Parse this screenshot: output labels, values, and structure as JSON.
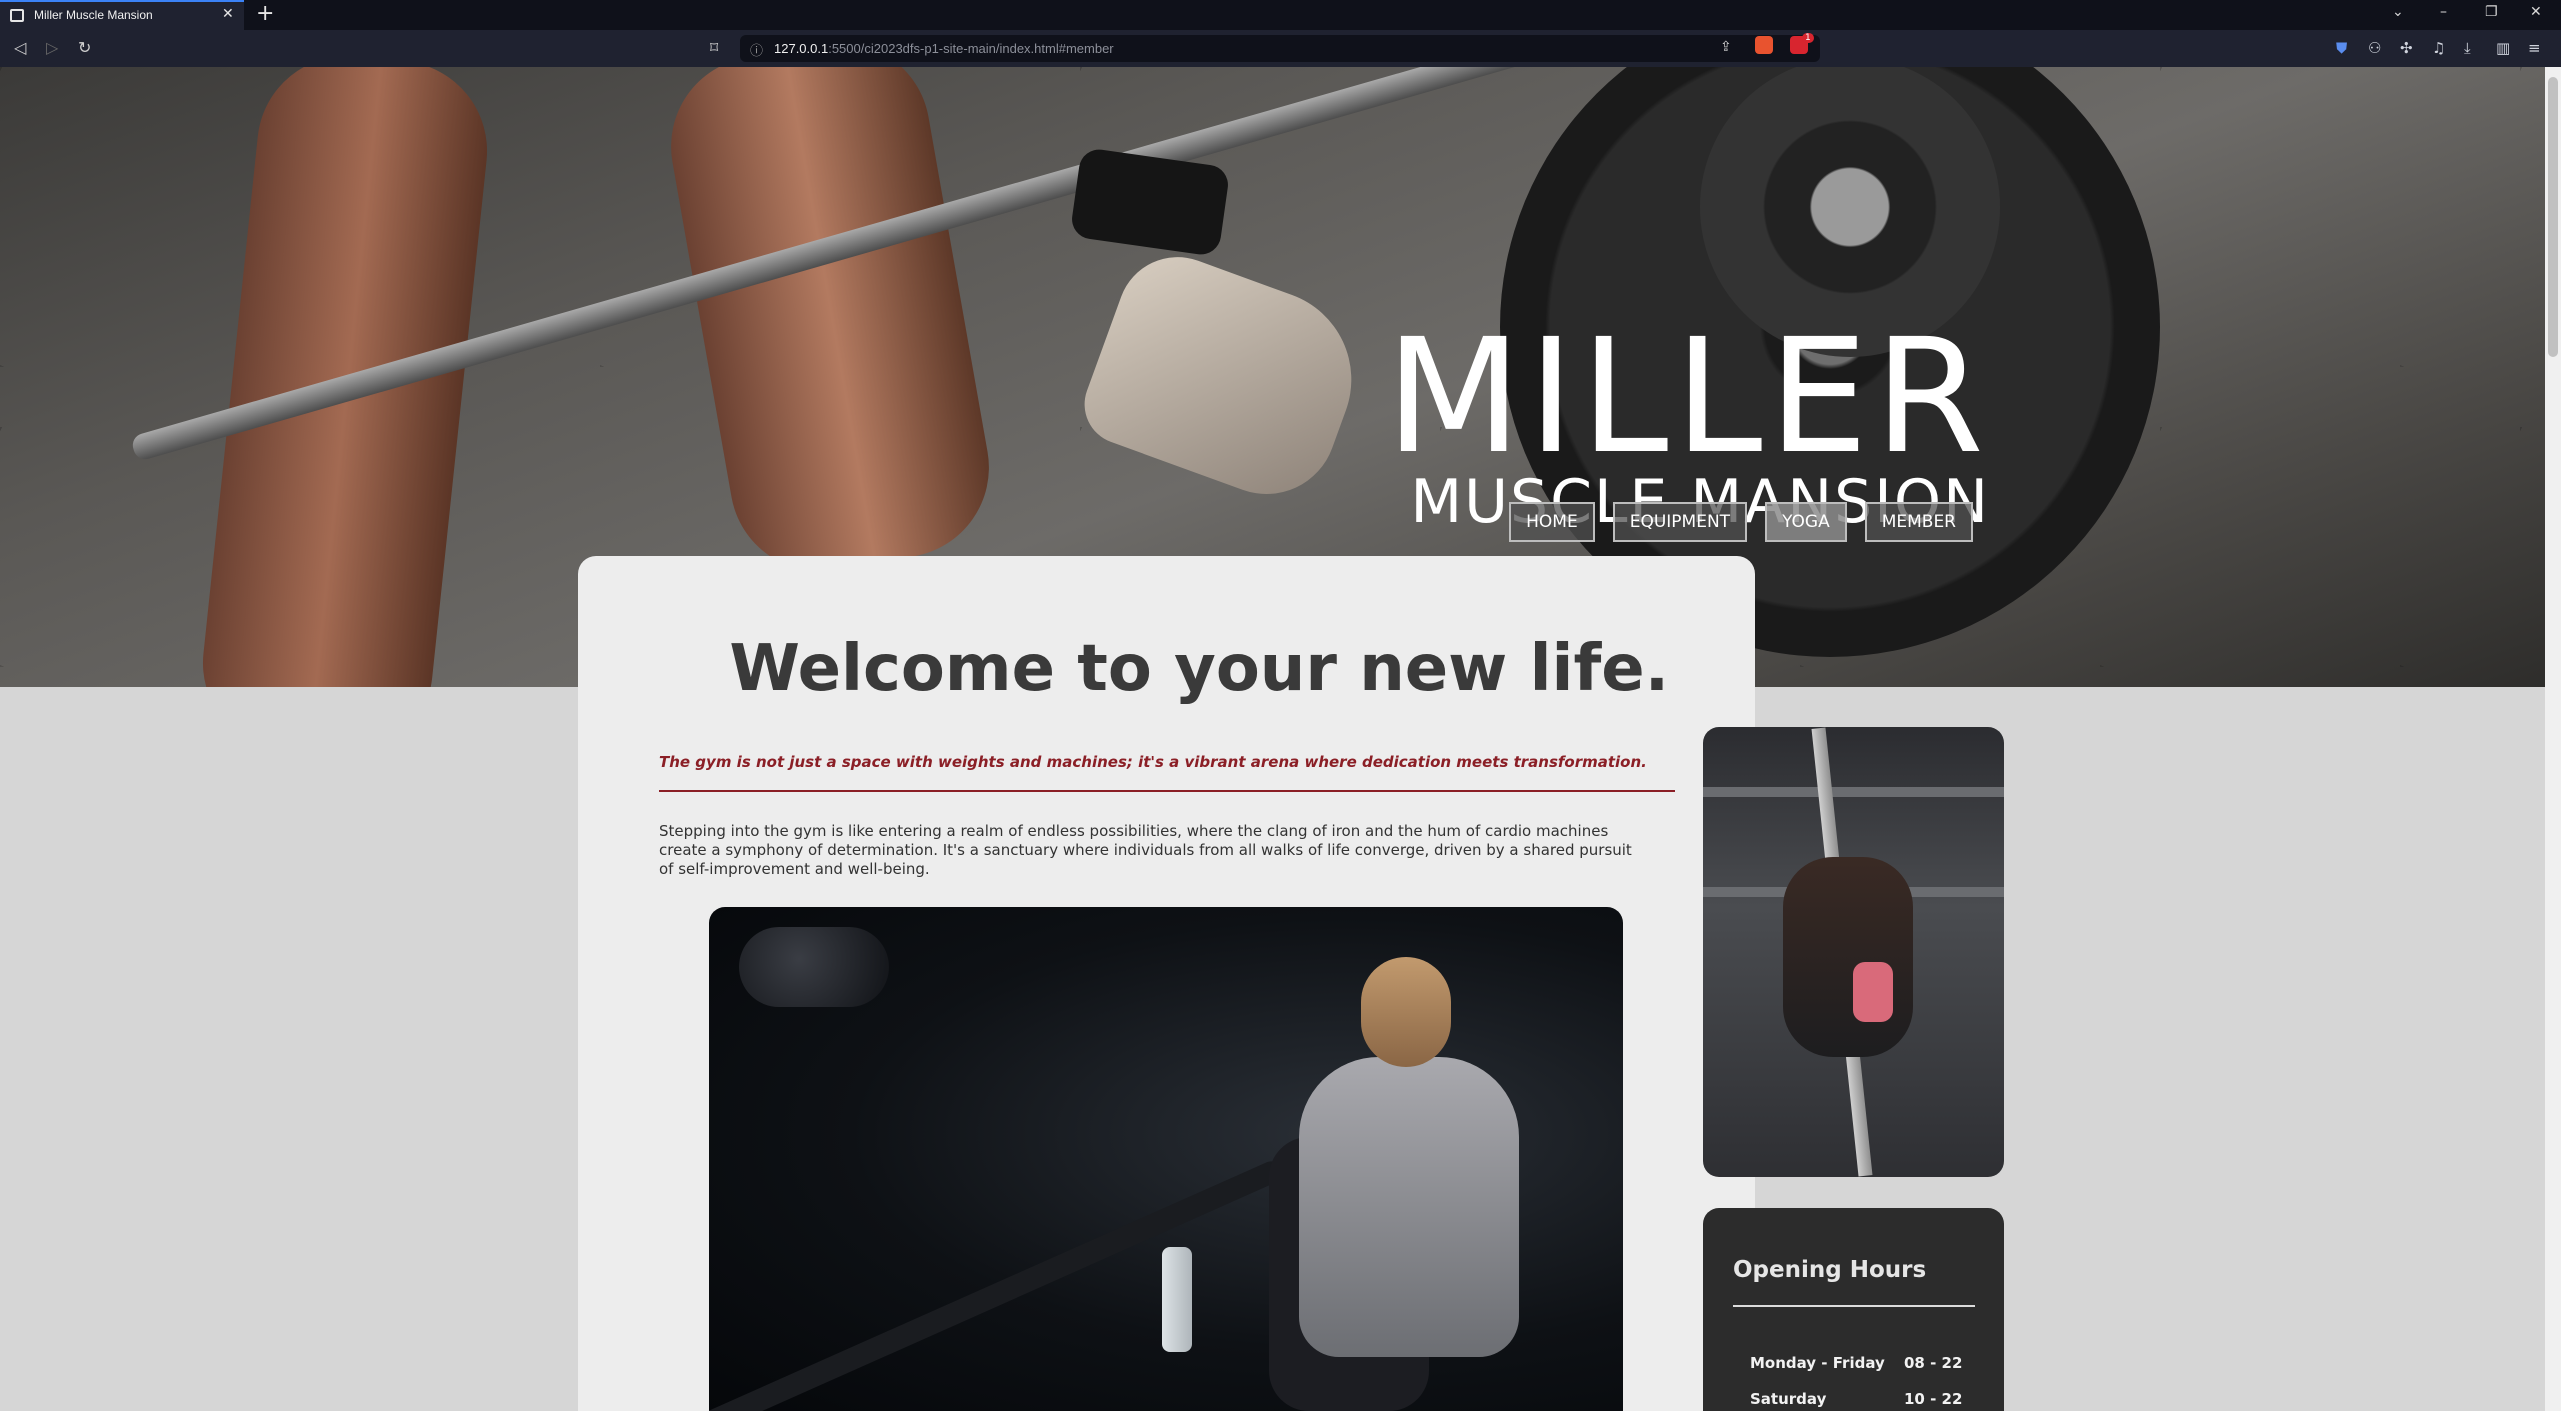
{
  "browser": {
    "tab_title": "Miller Muscle Mansion",
    "url_host": "127.0.0.1",
    "url_rest": ":5500/ci2023dfs-p1-site-main/index.html#member",
    "shield_badge": "1"
  },
  "hero": {
    "brand_title": "MILLER",
    "brand_subtitle": "MUSCLE MANSION"
  },
  "menu": {
    "items": [
      {
        "label": "HOME"
      },
      {
        "label": "EQUIPMENT"
      },
      {
        "label": "YOGA"
      },
      {
        "label": "MEMBER"
      }
    ]
  },
  "main": {
    "heading": "Welcome to your new life.",
    "quote": "The gym is not just a space with weights and machines; it's a vibrant arena where dedication meets transformation.",
    "paragraph": "Stepping into the gym is like entering a realm of endless possibilities, where the clang of iron and the hum of cardio machines create a symphony of determination. It's a sanctuary where individuals from all walks of life converge, driven by a shared pursuit of self-improvement and well-being."
  },
  "hours": {
    "title": "Opening Hours",
    "rows": [
      {
        "day": "Monday - Friday",
        "time": "08 - 22"
      },
      {
        "day": "Saturday",
        "time": "10 - 22"
      }
    ]
  }
}
